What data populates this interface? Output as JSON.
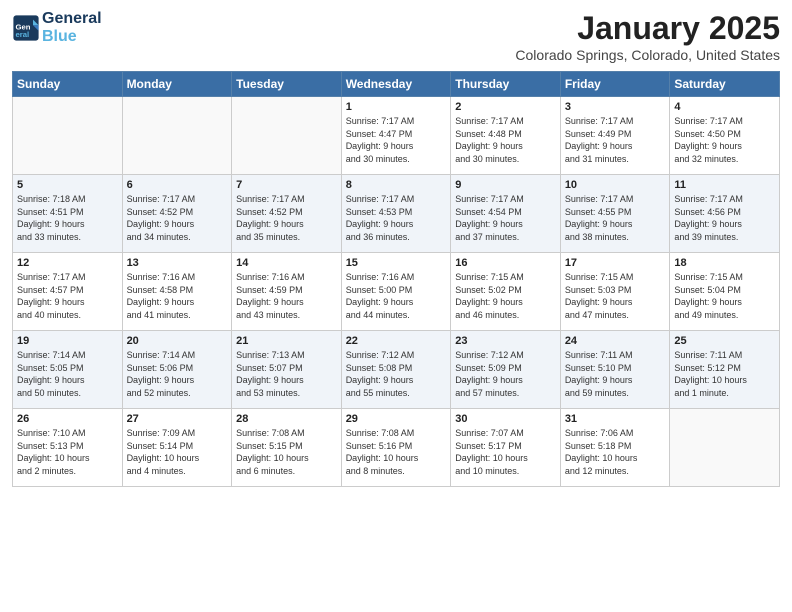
{
  "header": {
    "logo_line1": "General",
    "logo_line2": "Blue",
    "month": "January 2025",
    "location": "Colorado Springs, Colorado, United States"
  },
  "weekdays": [
    "Sunday",
    "Monday",
    "Tuesday",
    "Wednesday",
    "Thursday",
    "Friday",
    "Saturday"
  ],
  "weeks": [
    [
      {
        "day": "",
        "info": ""
      },
      {
        "day": "",
        "info": ""
      },
      {
        "day": "",
        "info": ""
      },
      {
        "day": "1",
        "info": "Sunrise: 7:17 AM\nSunset: 4:47 PM\nDaylight: 9 hours\nand 30 minutes."
      },
      {
        "day": "2",
        "info": "Sunrise: 7:17 AM\nSunset: 4:48 PM\nDaylight: 9 hours\nand 30 minutes."
      },
      {
        "day": "3",
        "info": "Sunrise: 7:17 AM\nSunset: 4:49 PM\nDaylight: 9 hours\nand 31 minutes."
      },
      {
        "day": "4",
        "info": "Sunrise: 7:17 AM\nSunset: 4:50 PM\nDaylight: 9 hours\nand 32 minutes."
      }
    ],
    [
      {
        "day": "5",
        "info": "Sunrise: 7:18 AM\nSunset: 4:51 PM\nDaylight: 9 hours\nand 33 minutes."
      },
      {
        "day": "6",
        "info": "Sunrise: 7:17 AM\nSunset: 4:52 PM\nDaylight: 9 hours\nand 34 minutes."
      },
      {
        "day": "7",
        "info": "Sunrise: 7:17 AM\nSunset: 4:52 PM\nDaylight: 9 hours\nand 35 minutes."
      },
      {
        "day": "8",
        "info": "Sunrise: 7:17 AM\nSunset: 4:53 PM\nDaylight: 9 hours\nand 36 minutes."
      },
      {
        "day": "9",
        "info": "Sunrise: 7:17 AM\nSunset: 4:54 PM\nDaylight: 9 hours\nand 37 minutes."
      },
      {
        "day": "10",
        "info": "Sunrise: 7:17 AM\nSunset: 4:55 PM\nDaylight: 9 hours\nand 38 minutes."
      },
      {
        "day": "11",
        "info": "Sunrise: 7:17 AM\nSunset: 4:56 PM\nDaylight: 9 hours\nand 39 minutes."
      }
    ],
    [
      {
        "day": "12",
        "info": "Sunrise: 7:17 AM\nSunset: 4:57 PM\nDaylight: 9 hours\nand 40 minutes."
      },
      {
        "day": "13",
        "info": "Sunrise: 7:16 AM\nSunset: 4:58 PM\nDaylight: 9 hours\nand 41 minutes."
      },
      {
        "day": "14",
        "info": "Sunrise: 7:16 AM\nSunset: 4:59 PM\nDaylight: 9 hours\nand 43 minutes."
      },
      {
        "day": "15",
        "info": "Sunrise: 7:16 AM\nSunset: 5:00 PM\nDaylight: 9 hours\nand 44 minutes."
      },
      {
        "day": "16",
        "info": "Sunrise: 7:15 AM\nSunset: 5:02 PM\nDaylight: 9 hours\nand 46 minutes."
      },
      {
        "day": "17",
        "info": "Sunrise: 7:15 AM\nSunset: 5:03 PM\nDaylight: 9 hours\nand 47 minutes."
      },
      {
        "day": "18",
        "info": "Sunrise: 7:15 AM\nSunset: 5:04 PM\nDaylight: 9 hours\nand 49 minutes."
      }
    ],
    [
      {
        "day": "19",
        "info": "Sunrise: 7:14 AM\nSunset: 5:05 PM\nDaylight: 9 hours\nand 50 minutes."
      },
      {
        "day": "20",
        "info": "Sunrise: 7:14 AM\nSunset: 5:06 PM\nDaylight: 9 hours\nand 52 minutes."
      },
      {
        "day": "21",
        "info": "Sunrise: 7:13 AM\nSunset: 5:07 PM\nDaylight: 9 hours\nand 53 minutes."
      },
      {
        "day": "22",
        "info": "Sunrise: 7:12 AM\nSunset: 5:08 PM\nDaylight: 9 hours\nand 55 minutes."
      },
      {
        "day": "23",
        "info": "Sunrise: 7:12 AM\nSunset: 5:09 PM\nDaylight: 9 hours\nand 57 minutes."
      },
      {
        "day": "24",
        "info": "Sunrise: 7:11 AM\nSunset: 5:10 PM\nDaylight: 9 hours\nand 59 minutes."
      },
      {
        "day": "25",
        "info": "Sunrise: 7:11 AM\nSunset: 5:12 PM\nDaylight: 10 hours\nand 1 minute."
      }
    ],
    [
      {
        "day": "26",
        "info": "Sunrise: 7:10 AM\nSunset: 5:13 PM\nDaylight: 10 hours\nand 2 minutes."
      },
      {
        "day": "27",
        "info": "Sunrise: 7:09 AM\nSunset: 5:14 PM\nDaylight: 10 hours\nand 4 minutes."
      },
      {
        "day": "28",
        "info": "Sunrise: 7:08 AM\nSunset: 5:15 PM\nDaylight: 10 hours\nand 6 minutes."
      },
      {
        "day": "29",
        "info": "Sunrise: 7:08 AM\nSunset: 5:16 PM\nDaylight: 10 hours\nand 8 minutes."
      },
      {
        "day": "30",
        "info": "Sunrise: 7:07 AM\nSunset: 5:17 PM\nDaylight: 10 hours\nand 10 minutes."
      },
      {
        "day": "31",
        "info": "Sunrise: 7:06 AM\nSunset: 5:18 PM\nDaylight: 10 hours\nand 12 minutes."
      },
      {
        "day": "",
        "info": ""
      }
    ]
  ]
}
